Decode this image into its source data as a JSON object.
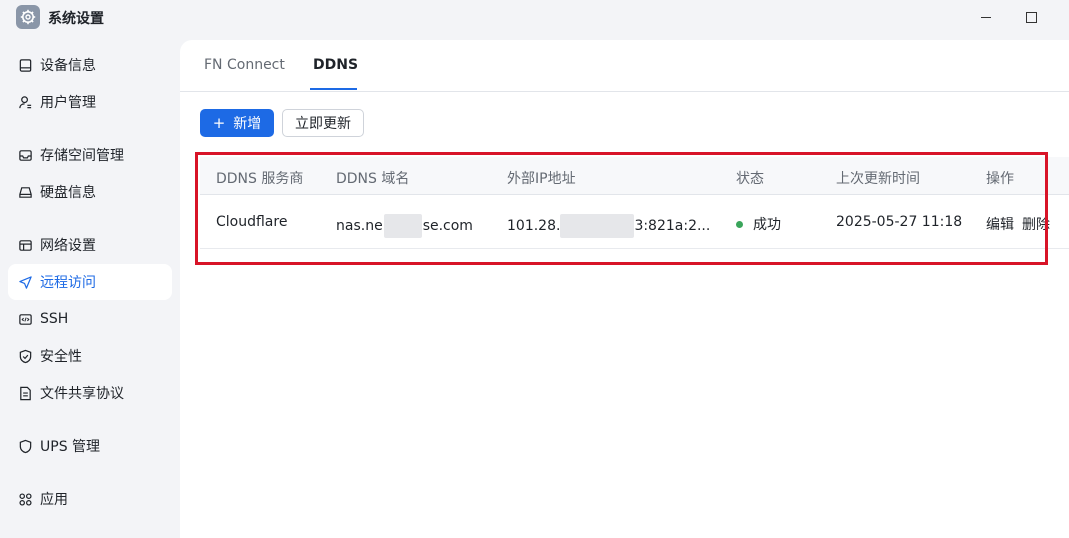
{
  "window": {
    "title": "系统设置"
  },
  "sidebar": {
    "items": [
      {
        "label": "设备信息",
        "icon": "device-icon"
      },
      {
        "label": "用户管理",
        "icon": "user-icon"
      },
      {
        "label": "存储空间管理",
        "icon": "storage-icon"
      },
      {
        "label": "硬盘信息",
        "icon": "disk-icon"
      },
      {
        "label": "网络设置",
        "icon": "network-icon"
      },
      {
        "label": "远程访问",
        "icon": "send-icon",
        "active": true
      },
      {
        "label": "SSH",
        "icon": "code-icon"
      },
      {
        "label": "安全性",
        "icon": "shield-check-icon"
      },
      {
        "label": "文件共享协议",
        "icon": "file-icon"
      },
      {
        "label": "UPS 管理",
        "icon": "shield-icon"
      },
      {
        "label": "应用",
        "icon": "apps-icon"
      }
    ]
  },
  "tabs": [
    {
      "label": "FN Connect"
    },
    {
      "label": "DDNS",
      "active": true
    }
  ],
  "toolbar": {
    "add_label": "新增",
    "refresh_label": "立即更新"
  },
  "table": {
    "headers": [
      "DDNS 服务商",
      "DDNS 域名",
      "外部IP地址",
      "状态",
      "上次更新时间",
      "操作"
    ],
    "rows": [
      {
        "provider": "Cloudflare",
        "domain_prefix": "nas.ne",
        "domain_suffix": "se.com",
        "ip_prefix": "101.28.",
        "ip_suffix": "3:821a:2...",
        "status": "成功",
        "updated": "2025-05-27 11:18",
        "edit": "编辑",
        "delete": "删除"
      }
    ]
  },
  "colors": {
    "accent": "#1d6ae5",
    "success": "#3aa55b",
    "highlight": "#d81428"
  }
}
